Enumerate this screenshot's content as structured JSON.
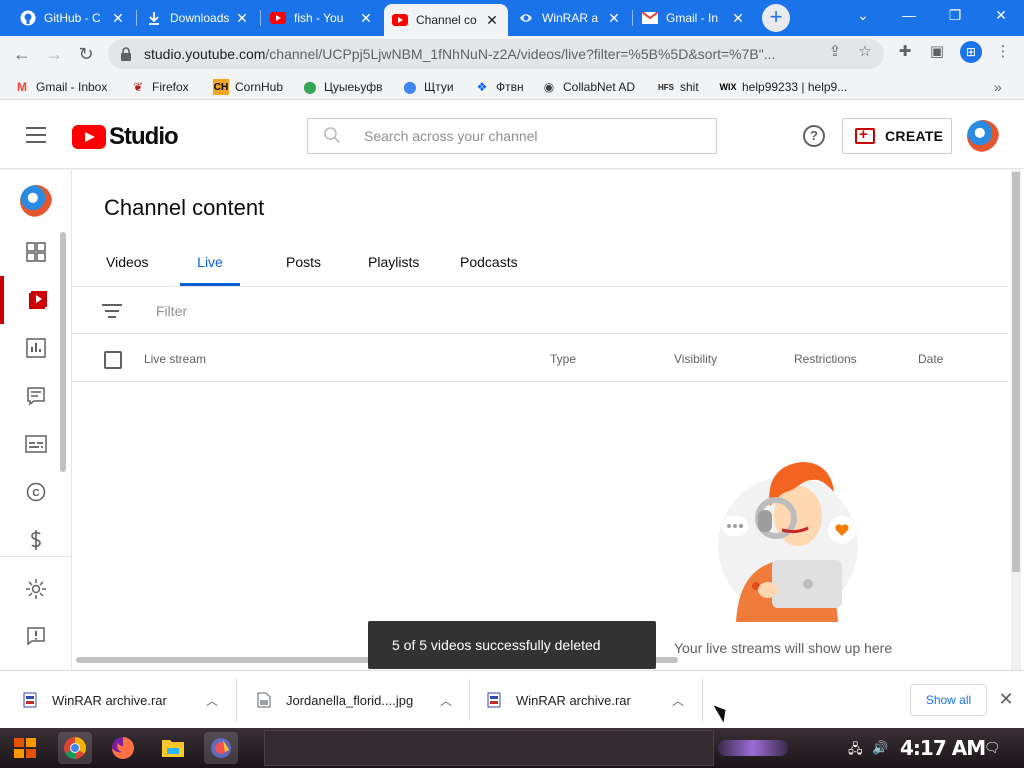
{
  "browser": {
    "tabs": [
      {
        "title": "GitHub - C",
        "icon": "github-icon"
      },
      {
        "title": "Downloads",
        "icon": "download-icon"
      },
      {
        "title": "fish - You",
        "icon": "youtube-icon"
      },
      {
        "title": "Channel co",
        "icon": "youtube-studio-icon",
        "active": true
      },
      {
        "title": "WinRAR a",
        "icon": "winrar-icon"
      },
      {
        "title": "Gmail - In",
        "icon": "gmail-icon"
      }
    ],
    "url_host": "studio.youtube.com",
    "url_path": "/channel/UCPpj5LjwNBM_1fNhNuN-z2A/videos/live?filter=%5B%5D&sort=%7B\"...",
    "bookmarks": [
      {
        "label": "Gmail - Inbox",
        "icon": "gmail-icon"
      },
      {
        "label": "Firefox",
        "icon": "firefox-icon"
      },
      {
        "label": "CornHub",
        "icon": "cornhub-icon"
      },
      {
        "label": "Цуыеьуфв",
        "icon": "maps-pin-icon"
      },
      {
        "label": "Щтуи",
        "icon": "maps-pin-icon"
      },
      {
        "label": "Фтвн",
        "icon": "dropbox-icon"
      },
      {
        "label": "CollabNet AD",
        "icon": "globe-icon"
      },
      {
        "label": "shit",
        "icon": "hfs-icon"
      },
      {
        "label": "help99233 | help9...",
        "icon": "wix-icon"
      }
    ],
    "bookmarks_overflow": "»"
  },
  "studio": {
    "logo_text": "Studio",
    "search_placeholder": "Search across your channel",
    "help_glyph": "?",
    "create_label": "CREATE"
  },
  "main": {
    "title": "Channel content",
    "tabs": [
      "Videos",
      "Live",
      "Posts",
      "Playlists",
      "Podcasts"
    ],
    "active_tab": "Live",
    "filter_label": "Filter",
    "columns": [
      "Live stream",
      "Type",
      "Visibility",
      "Restrictions",
      "Date"
    ],
    "empty_message": "Your live streams will show up here"
  },
  "toast": "5 of 5 videos successfully deleted",
  "downloads": {
    "items": [
      {
        "name": "WinRAR archive.rar",
        "icon": "winrar-file-icon"
      },
      {
        "name": "Jordanella_florid....jpg",
        "icon": "image-file-icon"
      },
      {
        "name": "WinRAR archive.rar",
        "icon": "winrar-file-icon"
      }
    ],
    "show_all": "Show all",
    "close_glyph": "✕"
  },
  "taskbar": {
    "clock": "4:17 AM"
  },
  "colors": {
    "chrome_blue": "#1a73e8",
    "yt_red": "#ff0000",
    "studio_red": "#cc0000",
    "link_blue": "#065fd4",
    "toast_bg": "#323232"
  }
}
